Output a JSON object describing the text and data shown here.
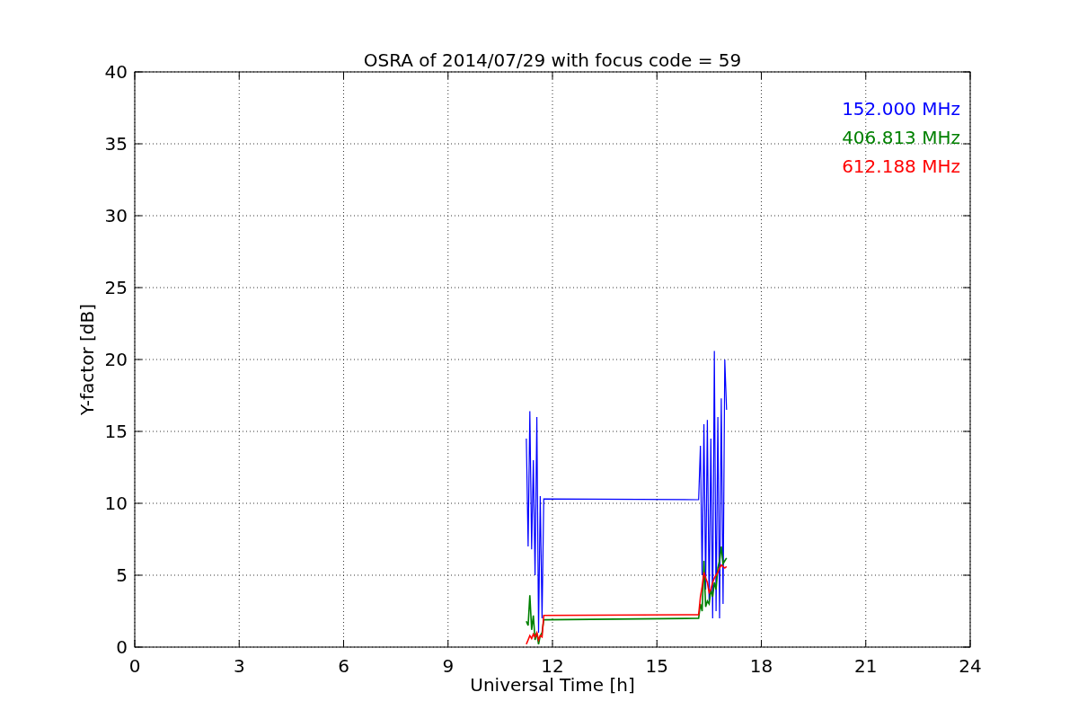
{
  "chart_data": {
    "type": "line",
    "title": "OSRA of 2014/07/29 with focus code = 59",
    "xlabel": "Universal Time [h]",
    "ylabel": "Y-factor [dB]",
    "x": [
      11.25,
      11.3,
      11.35,
      11.4,
      11.45,
      11.5,
      11.55,
      11.6,
      11.65,
      11.7,
      11.75,
      16.2,
      16.25,
      16.3,
      16.35,
      16.4,
      16.45,
      16.5,
      16.55,
      16.6,
      16.65,
      16.7,
      16.75,
      16.8,
      16.85,
      16.9,
      16.95,
      17.0
    ],
    "series": [
      {
        "name": "152.000 MHz",
        "color": "#0000ff",
        "values": [
          14.5,
          7,
          16.4,
          6.8,
          13,
          5,
          16,
          1,
          10.5,
          2,
          10.3,
          10.25,
          14,
          5,
          15.5,
          4,
          15.8,
          3,
          14.5,
          2,
          20.6,
          2.5,
          16,
          2,
          17.3,
          3,
          20,
          16.5
        ]
      },
      {
        "name": "406.813 MHz",
        "color": "#008000",
        "values": [
          1.8,
          1.5,
          3.6,
          1.2,
          2.2,
          0.5,
          1,
          0.2,
          0.8,
          1,
          1.9,
          2.0,
          3,
          2.5,
          6,
          2.8,
          3.2,
          3,
          4,
          3.5,
          4.5,
          4,
          5.5,
          6,
          7,
          5.8,
          6,
          6.2
        ]
      },
      {
        "name": "612.188 MHz",
        "color": "#ff0000",
        "values": [
          0.2,
          0.5,
          0.8,
          0.6,
          0.9,
          0.7,
          1,
          0.5,
          0.8,
          0.7,
          2.2,
          2.25,
          3.5,
          4.2,
          5.2,
          4.8,
          4.5,
          3.8,
          4,
          4.5,
          4.8,
          5,
          5.2,
          5.5,
          5.7,
          5.6,
          5.5,
          5.6
        ]
      }
    ],
    "xlim": [
      0,
      24
    ],
    "ylim": [
      0,
      40
    ],
    "xticks": [
      0,
      3,
      6,
      9,
      12,
      15,
      18,
      21,
      24
    ],
    "yticks": [
      0,
      5,
      10,
      15,
      20,
      25,
      30,
      35,
      40
    ],
    "grid": true
  }
}
